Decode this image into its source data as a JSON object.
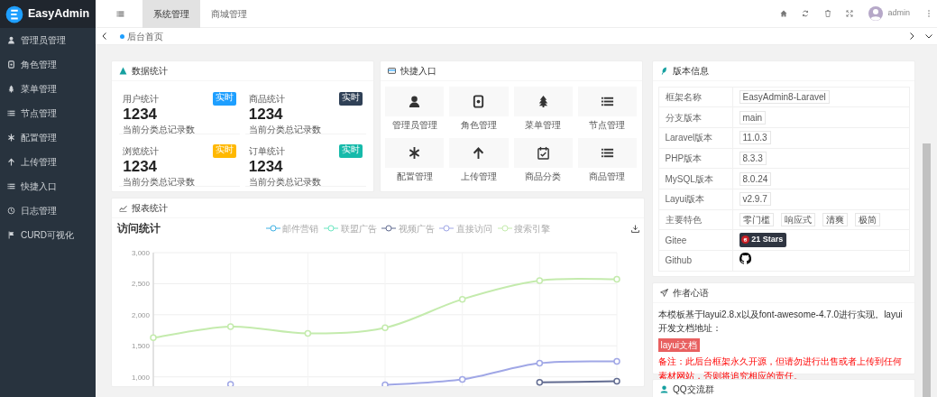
{
  "brand": {
    "name": "EasyAdmin"
  },
  "sidebar": {
    "items": [
      {
        "label": "管理员管理",
        "selected": false
      },
      {
        "label": "角色管理",
        "selected": false
      },
      {
        "label": "菜单管理",
        "selected": false
      },
      {
        "label": "节点管理",
        "selected": false
      },
      {
        "label": "配置管理",
        "selected": false
      },
      {
        "label": "上传管理",
        "selected": false
      },
      {
        "label": "快捷入口",
        "selected": false
      },
      {
        "label": "日志管理",
        "selected": false
      },
      {
        "label": "CURD可视化",
        "selected": false
      }
    ]
  },
  "header": {
    "menus": [
      {
        "label": "系统管理",
        "selected": true
      },
      {
        "label": "商城管理",
        "selected": false
      }
    ],
    "user": "admin"
  },
  "page_tabs": [
    {
      "label": "后台首页",
      "selected": true
    }
  ],
  "stats": {
    "title": "数据统计",
    "items": [
      {
        "label": "用户统计",
        "value": "1234",
        "note": "当前分类总记录数",
        "tag": "实时",
        "color": "#1e9fff"
      },
      {
        "label": "商品统计",
        "value": "1234",
        "note": "当前分类总记录数",
        "tag": "实时",
        "color": "#2f4056"
      },
      {
        "label": "浏览统计",
        "value": "1234",
        "note": "当前分类总记录数",
        "tag": "实时",
        "color": "#ffb800"
      },
      {
        "label": "订单统计",
        "value": "1234",
        "note": "当前分类总记录数",
        "tag": "实时",
        "color": "#16baaa"
      }
    ]
  },
  "shortcuts": {
    "title": "快捷入口",
    "items": [
      {
        "label": "管理员管理"
      },
      {
        "label": "角色管理"
      },
      {
        "label": "菜单管理"
      },
      {
        "label": "节点管理"
      },
      {
        "label": "配置管理"
      },
      {
        "label": "上传管理"
      },
      {
        "label": "商品分类"
      },
      {
        "label": "商品管理"
      }
    ]
  },
  "report": {
    "title": "报表统计",
    "chart_title": "访问统计",
    "chart_data": {
      "type": "line",
      "grid": true,
      "ylim": [
        850,
        3000
      ],
      "yticks": [
        {
          "value": 1000,
          "label": "1,000"
        },
        {
          "value": 1500,
          "label": "1,500"
        },
        {
          "value": 2000,
          "label": "2,000"
        },
        {
          "value": 2500,
          "label": "2,500"
        },
        {
          "value": 3000,
          "label": "3,000"
        }
      ],
      "series": [
        {
          "name": "邮件营销",
          "color": "#3fb1e3",
          "values": [
            null,
            null,
            null,
            null,
            null,
            null,
            null
          ]
        },
        {
          "name": "联盟广告",
          "color": "#6be6c1",
          "values": [
            null,
            null,
            null,
            null,
            null,
            null,
            null
          ]
        },
        {
          "name": "视频广告",
          "color": "#626c91",
          "marker": true,
          "values": [
            null,
            null,
            null,
            null,
            null,
            910,
            930
          ]
        },
        {
          "name": "直接访问",
          "color": "#a0a7e6",
          "marker": true,
          "values": [
            null,
            880,
            null,
            870,
            960,
            1220,
            1250
          ]
        },
        {
          "name": "搜索引擎",
          "color": "#c4ebad",
          "marker": true,
          "values": [
            1630,
            1810,
            1700,
            1790,
            2250,
            2550,
            2570
          ]
        }
      ]
    }
  },
  "version": {
    "title": "版本信息",
    "rows": [
      {
        "kind": "tags",
        "label": "框架名称",
        "tags": [
          "EasyAdmin8-Laravel"
        ]
      },
      {
        "kind": "tags",
        "label": "分支版本",
        "tags": [
          "main"
        ]
      },
      {
        "kind": "tags",
        "label": "Laravel版本",
        "tags": [
          "11.0.3"
        ]
      },
      {
        "kind": "tags",
        "label": "PHP版本",
        "tags": [
          "8.3.3"
        ]
      },
      {
        "kind": "tags",
        "label": "MySQL版本",
        "tags": [
          "8.0.24"
        ]
      },
      {
        "kind": "tags",
        "label": "Layui版本",
        "tags": [
          "v2.9.7"
        ]
      },
      {
        "kind": "tags",
        "label": "主要特色",
        "tags": [
          "零门槛",
          "响应式",
          "清爽",
          "极简"
        ]
      },
      {
        "kind": "stars",
        "label": "Gitee",
        "badge": "21 Stars"
      },
      {
        "kind": "github",
        "label": "Github"
      }
    ]
  },
  "author": {
    "title": "作者心语",
    "text": "本模板基于layui2.8.x以及font-awesome-4.7.0进行实现。layui开发文档地址：",
    "link": "layui文档",
    "notice": "备注：此后台框架永久开源，但请勿进行出售或者上传到任何素材网站，否则将追究相应的责任。"
  },
  "qq": {
    "title": "QQ交流群"
  }
}
